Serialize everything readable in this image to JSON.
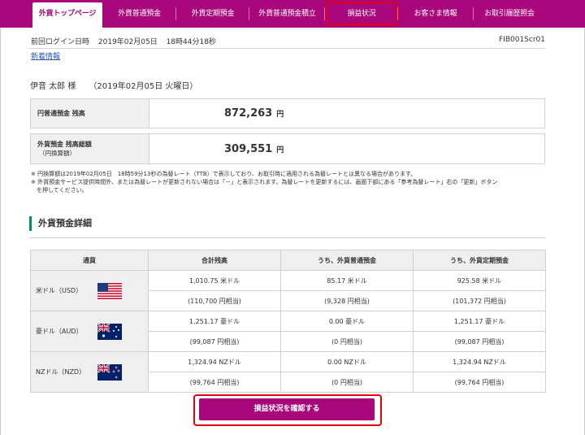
{
  "nav": {
    "tabs": [
      {
        "label": "外貨トップページ"
      },
      {
        "label": "外貨普通預金"
      },
      {
        "label": "外貨定期預金"
      },
      {
        "label": "外貨普通預金積立"
      },
      {
        "label": "損益状況"
      },
      {
        "label": "お客さま情報"
      },
      {
        "label": "お取引履歴照会"
      }
    ],
    "active_index": 0,
    "highlight_index": 4
  },
  "header": {
    "last_login_label": "前回ログイン日時",
    "last_login_date": "2019年02月05日",
    "last_login_time": "18時44分18秒",
    "screen_id": "FIB001Scr01",
    "new_info_link": "新着情報"
  },
  "user": {
    "name": "伊音 太郎 様",
    "date": "（2019年02月05日 火曜日）"
  },
  "balances": {
    "jpy": {
      "label": "円普通預金 残高",
      "amount": "872,263",
      "unit": "円"
    },
    "fx": {
      "label": "外貨預金 残高総額",
      "sub": "（円換算額）",
      "amount": "309,551",
      "unit": "円"
    }
  },
  "notes": [
    "※ 円換算額は2019年02月05日　18時59分13秒の為替レート（TTB）で表示しており、お取引時に適用される為替レートとは異なる場合があります。",
    "※ 外貨預金サービス提供時間外、または為替レートが更新されない場合は「－」と表示されます。為替レートを更新するには、画面下部にある「参考為替レート」右の「更新」ボタン",
    "　を押してください。"
  ],
  "section": {
    "title": "外貨預金詳細"
  },
  "table": {
    "headers": [
      "通貨",
      "合計残高",
      "うち、外貨普通預金",
      "うち、外貨定期預金"
    ],
    "rows": [
      {
        "currency": "米ドル（USD）",
        "flag": "us-flag-icon",
        "total": "1,010.75 米ドル",
        "total_jpy": "(110,700 円相当)",
        "ordinary": "85.17 米ドル",
        "ordinary_jpy": "(9,328 円相当)",
        "time": "925.58 米ドル",
        "time_jpy": "(101,372 円相当)"
      },
      {
        "currency": "豪ドル（AUD）",
        "flag": "au-flag-icon",
        "total": "1,251.17 豪ドル",
        "total_jpy": "(99,087 円相当)",
        "ordinary": "0.00 豪ドル",
        "ordinary_jpy": "(0 円相当)",
        "time": "1,251.17 豪ドル",
        "time_jpy": "(99,087 円相当)"
      },
      {
        "currency": "NZドル（NZD）",
        "flag": "nz-flag-icon",
        "total": "1,324.94 NZドル",
        "total_jpy": "(99,764 円相当)",
        "ordinary": "0.00 NZドル",
        "ordinary_jpy": "(0 円相当)",
        "time": "1,324.94 NZドル",
        "time_jpy": "(99,764 円相当)"
      }
    ]
  },
  "confirm_button": {
    "label": "損益状況を確認する"
  },
  "colors": {
    "brand": "#a8067a",
    "accent": "#008a73",
    "highlight": "#e2000f"
  }
}
